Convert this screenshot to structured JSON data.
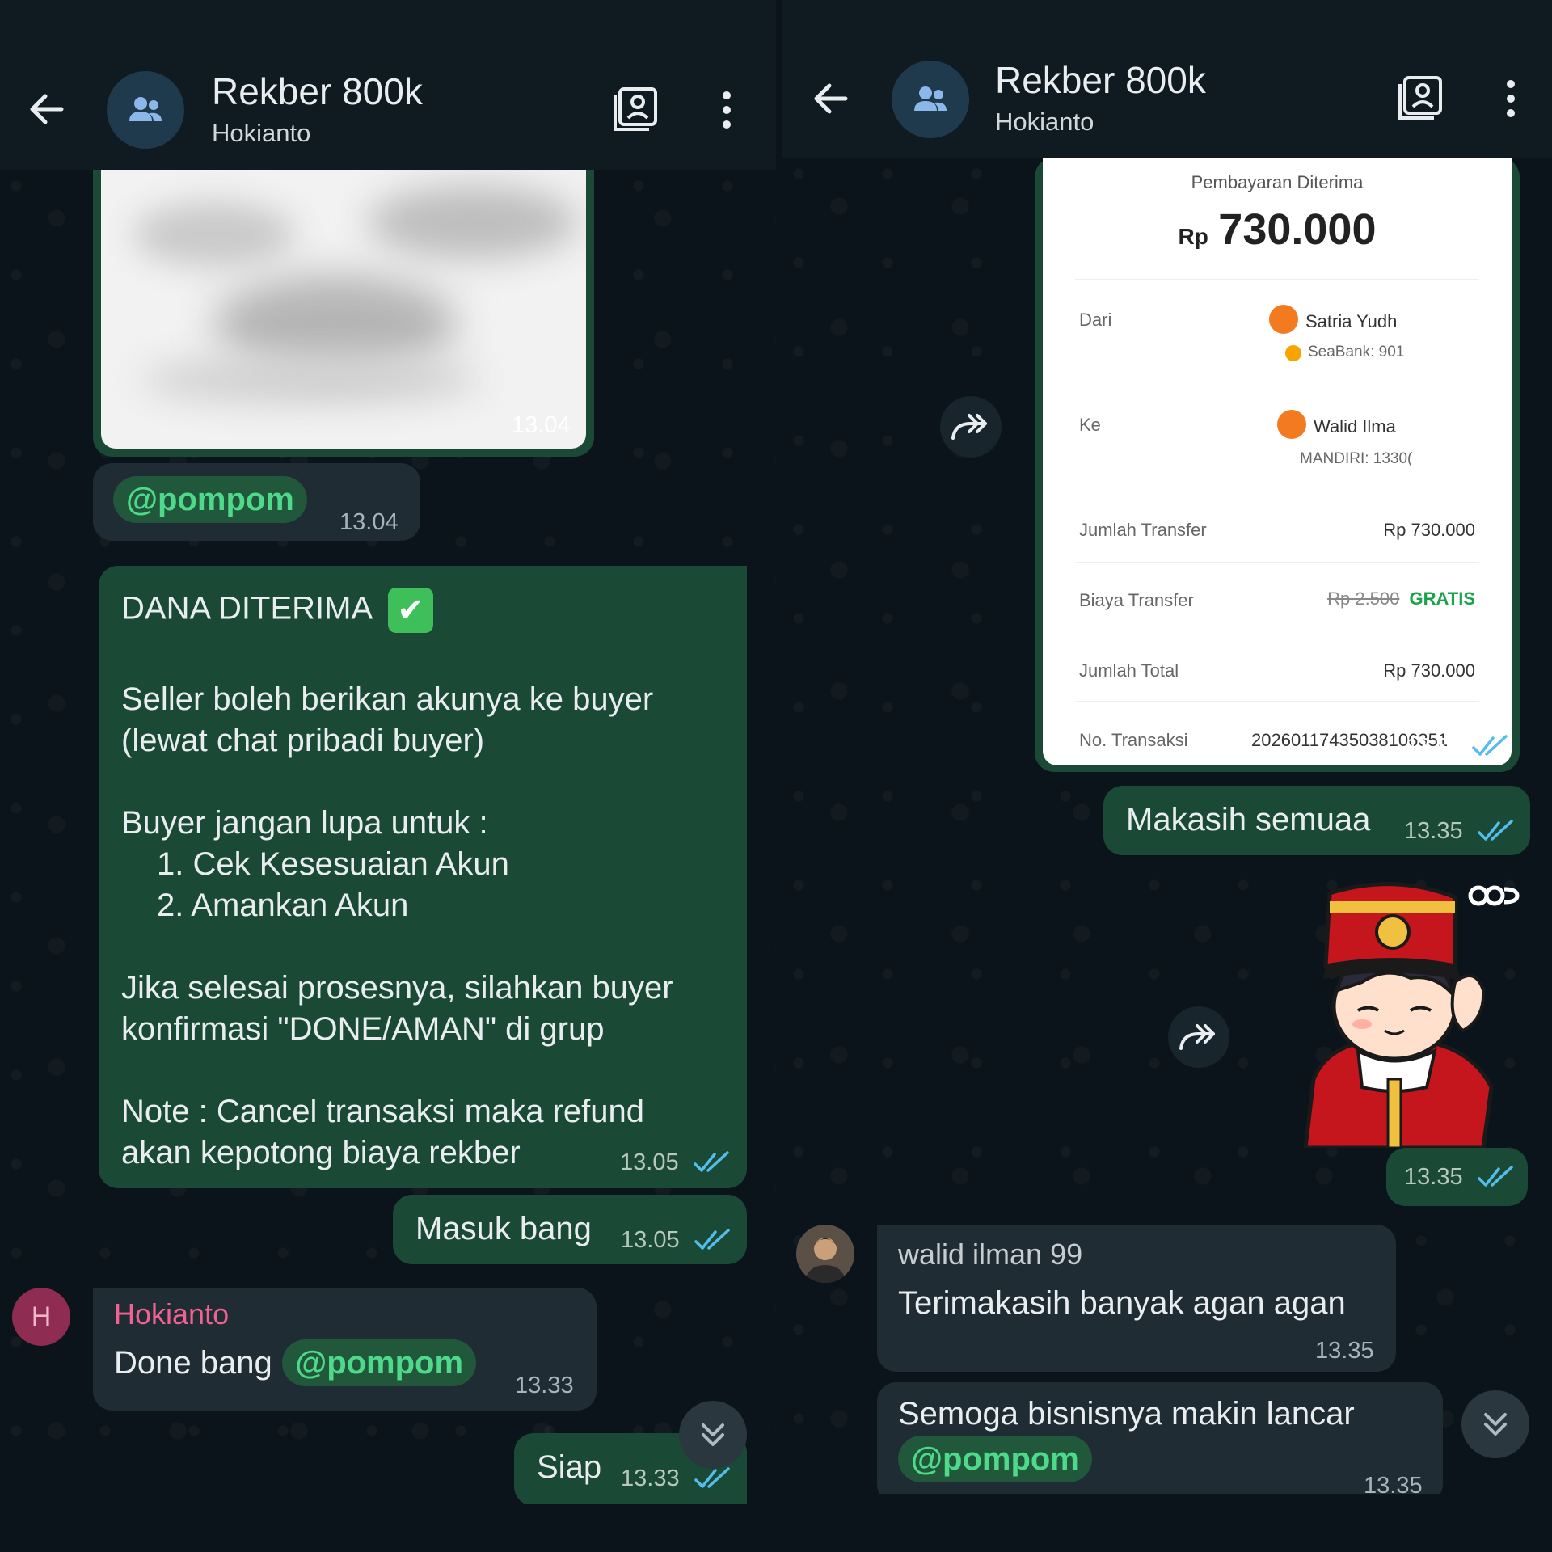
{
  "left": {
    "header": {
      "title": "Rekber 800k",
      "subtitle": "Hokianto"
    },
    "image_msg": {
      "time": "13.04"
    },
    "mention_msg": {
      "mention": "@pompom",
      "time": "13.04"
    },
    "dana_msg": {
      "line1": "DANA DITERIMA",
      "line2": "Seller boleh berikan akunya ke buyer",
      "line3": "(lewat chat pribadi buyer)",
      "line4": "Buyer jangan lupa untuk :",
      "line5": "1. Cek Kesesuaian Akun",
      "line6": "2. Amankan Akun",
      "line7": "Jika selesai prosesnya, silahkan buyer",
      "line8": "konfirmasi \"DONE/AMAN\" di grup",
      "line9": "Note : Cancel transaksi maka refund",
      "line10": "akan kepotong biaya rekber",
      "time": "13.05"
    },
    "masuk_msg": {
      "text": "Masuk bang",
      "time": "13.05"
    },
    "hokianto_msg": {
      "avatar_letter": "H",
      "sender": "Hokianto",
      "text": "Done bang",
      "mention": "@pompom",
      "time": "13.33"
    },
    "siap_msg": {
      "text": "Siap",
      "time": "13.33"
    }
  },
  "right": {
    "header": {
      "title": "Rekber 800k",
      "subtitle": "Hokianto"
    },
    "receipt": {
      "heading": "Pembayaran Diterima",
      "currency": "Rp",
      "amount": "730.000",
      "from_label": "Dari",
      "from_name": "Satria Yudh",
      "from_bank": "SeaBank: 901",
      "to_label": "Ke",
      "to_name": "Walid Ilma",
      "to_bank": "MANDIRI: 1330(",
      "transfer_label": "Jumlah Transfer",
      "transfer_value": "Rp 730.000",
      "fee_label": "Biaya Transfer",
      "fee_old": "Rp 2.500",
      "fee_new": "GRATIS",
      "total_label": "Jumlah Total",
      "total_value": "Rp 730.000",
      "trx_label": "No. Transaksi",
      "trx_value": "20260117435038106351",
      "time": "13.35"
    },
    "makasih_msg": {
      "text": "Makasih semuaa",
      "time": "13.35"
    },
    "sticker_msg": {
      "time": "13.35"
    },
    "walid_msg1": {
      "sender": "walid ilman 99",
      "text": "Terimakasih banyak agan agan",
      "time": "13.35"
    },
    "walid_msg2": {
      "text": "Semoga bisnisnya makin lancar",
      "mention": "@pompom",
      "time": "13.35"
    }
  },
  "colors": {
    "outgoing_bubble": "#1a4a36",
    "incoming_bubble": "#1f2c34",
    "mention": "#4fd98a",
    "read_ticks": "#53bdeb",
    "sender_hokianto": "#f06292"
  }
}
